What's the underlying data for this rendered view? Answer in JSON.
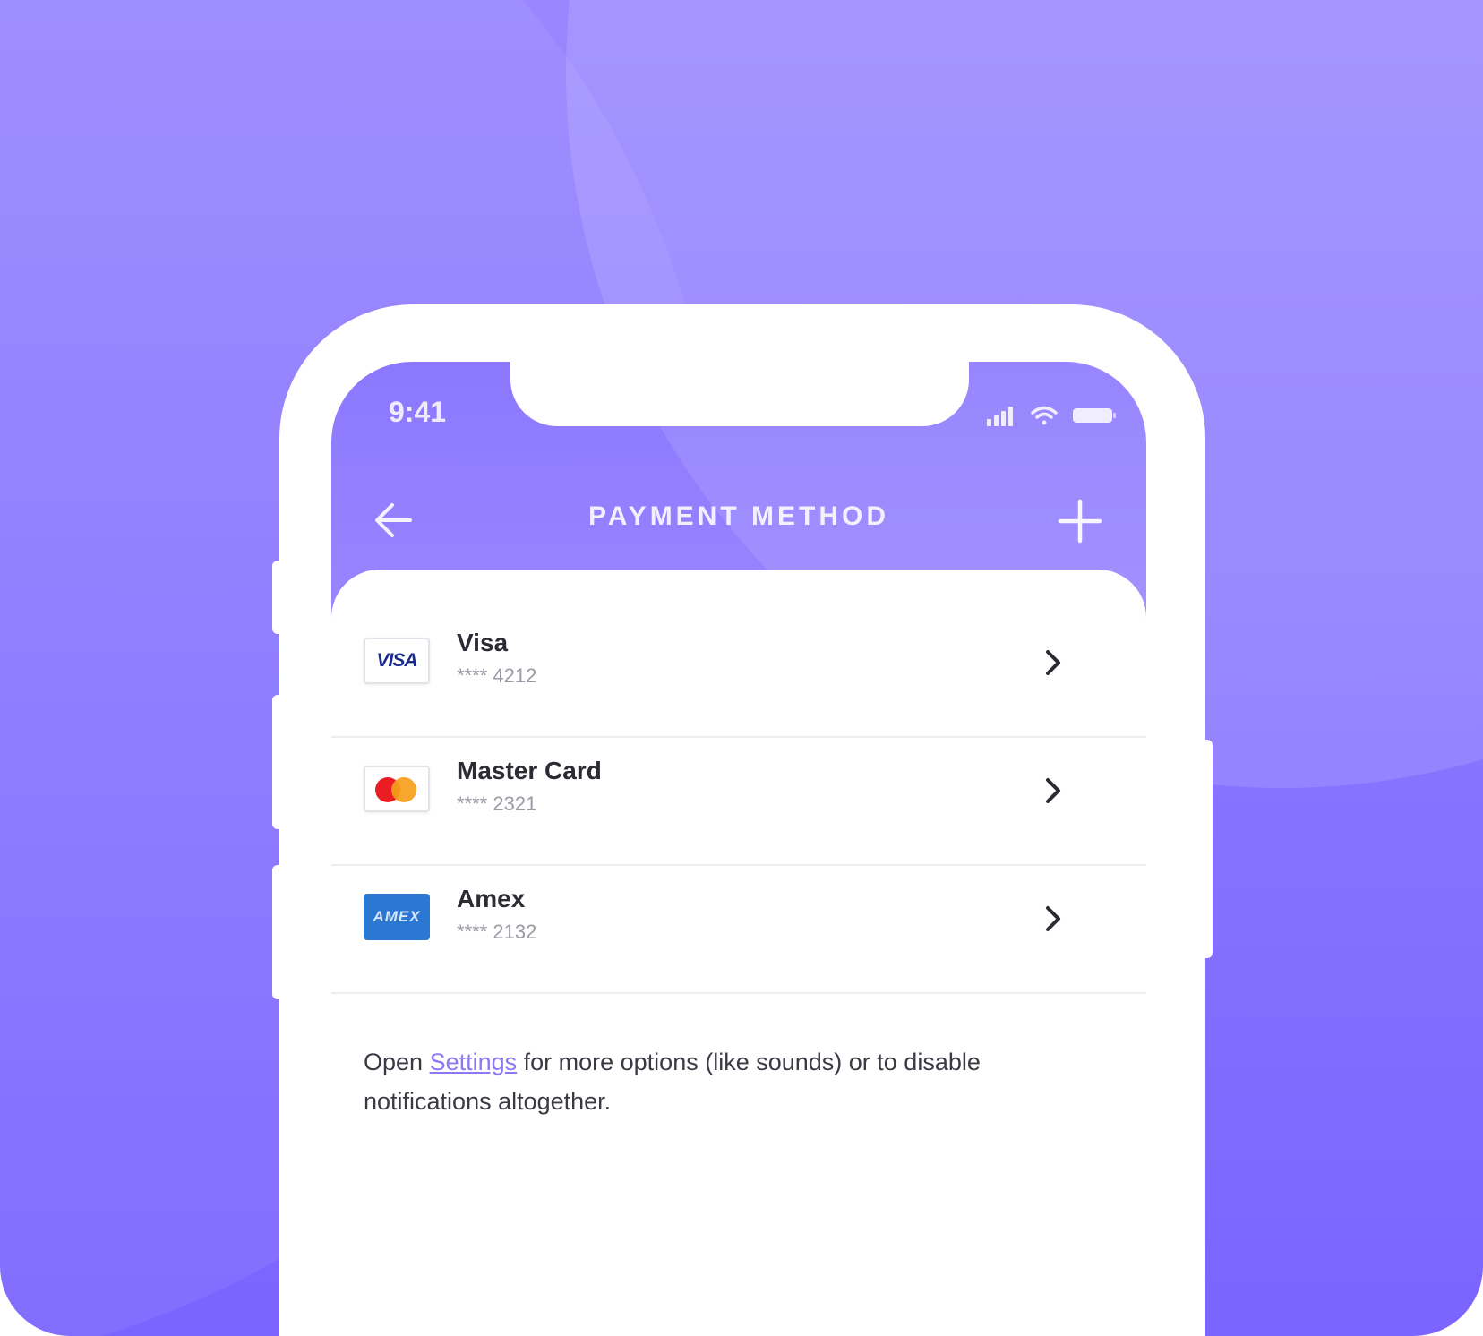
{
  "status_bar": {
    "time": "9:41",
    "icons": [
      "signal-icon",
      "wifi-icon",
      "battery-icon"
    ]
  },
  "nav": {
    "title": "PAYMENT METHOD",
    "back_icon": "arrow-left-icon",
    "add_icon": "plus-icon"
  },
  "cards": [
    {
      "name": "Visa",
      "number": "**** 4212",
      "logo_text": "VISA",
      "icon": "visa-logo-icon"
    },
    {
      "name": "Master Card",
      "number": "**** 2321",
      "icon": "mastercard-logo-icon"
    },
    {
      "name": "Amex",
      "number": "**** 2132",
      "logo_text": "AMEX",
      "icon": "amex-logo-icon"
    }
  ],
  "footer": {
    "prefix": "Open ",
    "link": "Settings",
    "suffix": " for more options (like sounds) or to disable notifications altogether."
  },
  "colors": {
    "background": "#8b78ff",
    "header": "#9380ff",
    "link": "#8a78f5",
    "visa_blue": "#1a2a8c",
    "mastercard_red": "#eb1c24",
    "mastercard_orange": "#f79e1b",
    "amex_blue": "#2a78d2"
  }
}
